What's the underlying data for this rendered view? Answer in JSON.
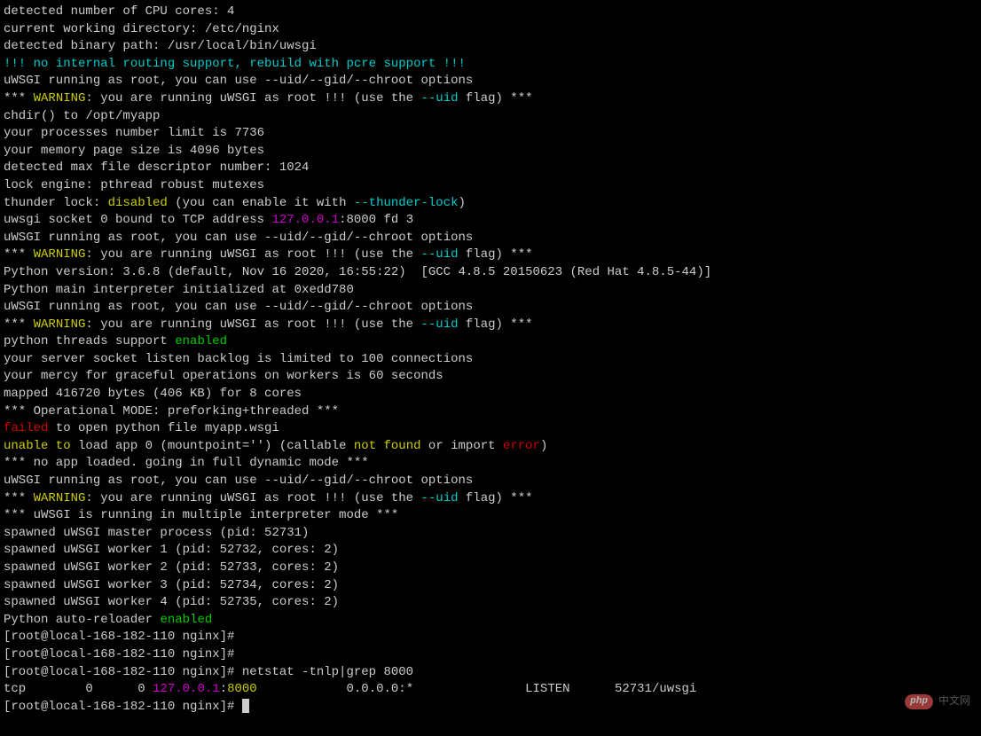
{
  "lines": [
    [
      {
        "t": "detected number of CPU cores: 4"
      }
    ],
    [
      {
        "t": "current working directory: /etc/nginx"
      }
    ],
    [
      {
        "t": "detected binary path: /usr/local/bin/uwsgi"
      }
    ],
    [
      {
        "t": "!!! no internal routing support, rebuild with pcre support !!!",
        "c": "cyan"
      }
    ],
    [
      {
        "t": "uWSGI running as root, you can use --uid/--gid/--chroot options"
      }
    ],
    [
      {
        "t": "*** "
      },
      {
        "t": "WARNING",
        "c": "yellow"
      },
      {
        "t": ": you are running uWSGI as root !!! (use the "
      },
      {
        "t": "--uid",
        "c": "cyan"
      },
      {
        "t": " flag) ***"
      }
    ],
    [
      {
        "t": "chdir() to /opt/myapp"
      }
    ],
    [
      {
        "t": "your processes number limit is 7736"
      }
    ],
    [
      {
        "t": "your memory page size is 4096 bytes"
      }
    ],
    [
      {
        "t": "detected max file descriptor number: 1024"
      }
    ],
    [
      {
        "t": "lock engine: pthread robust mutexes"
      }
    ],
    [
      {
        "t": "thunder lock: "
      },
      {
        "t": "disabled",
        "c": "yellow"
      },
      {
        "t": " (you can enable it with "
      },
      {
        "t": "--thunder-lock",
        "c": "cyan"
      },
      {
        "t": ")"
      }
    ],
    [
      {
        "t": "uwsgi socket 0 bound to TCP address "
      },
      {
        "t": "127.0.0.1",
        "c": "magenta"
      },
      {
        "t": ":8000 fd 3"
      }
    ],
    [
      {
        "t": "uWSGI running as root, you can use --uid/--gid/--chroot options"
      }
    ],
    [
      {
        "t": "*** "
      },
      {
        "t": "WARNING",
        "c": "yellow"
      },
      {
        "t": ": you are running uWSGI as root !!! (use the "
      },
      {
        "t": "--uid",
        "c": "cyan"
      },
      {
        "t": " flag) ***"
      }
    ],
    [
      {
        "t": "Python version: 3.6.8 (default, Nov 16 2020, 16:55:22)  [GCC 4.8.5 20150623 (Red Hat 4.8.5-44)]"
      }
    ],
    [
      {
        "t": "Python main interpreter initialized at 0xedd780"
      }
    ],
    [
      {
        "t": "uWSGI running as root, you can use --uid/--gid/--chroot options"
      }
    ],
    [
      {
        "t": "*** "
      },
      {
        "t": "WARNING",
        "c": "yellow"
      },
      {
        "t": ": you are running uWSGI as root !!! (use the "
      },
      {
        "t": "--uid",
        "c": "cyan"
      },
      {
        "t": " flag) ***"
      }
    ],
    [
      {
        "t": "python threads support "
      },
      {
        "t": "enabled",
        "c": "green"
      }
    ],
    [
      {
        "t": "your server socket listen backlog is limited to 100 connections"
      }
    ],
    [
      {
        "t": "your mercy for graceful operations on workers is 60 seconds"
      }
    ],
    [
      {
        "t": "mapped 416720 bytes (406 KB) for 8 cores"
      }
    ],
    [
      {
        "t": "*** Operational MODE: preforking+threaded ***"
      }
    ],
    [
      {
        "t": "failed",
        "c": "red"
      },
      {
        "t": " to open python file myapp.wsgi"
      }
    ],
    [
      {
        "t": "unable to",
        "c": "yellow"
      },
      {
        "t": " load app 0 (mountpoint='') (callable "
      },
      {
        "t": "not found",
        "c": "yellow"
      },
      {
        "t": " or import "
      },
      {
        "t": "error",
        "c": "red"
      },
      {
        "t": ")"
      }
    ],
    [
      {
        "t": "*** no app loaded. going in full dynamic mode ***"
      }
    ],
    [
      {
        "t": "uWSGI running as root, you can use --uid/--gid/--chroot options"
      }
    ],
    [
      {
        "t": "*** "
      },
      {
        "t": "WARNING",
        "c": "yellow"
      },
      {
        "t": ": you are running uWSGI as root !!! (use the "
      },
      {
        "t": "--uid",
        "c": "cyan"
      },
      {
        "t": " flag) ***"
      }
    ],
    [
      {
        "t": "*** uWSGI is running in multiple interpreter mode ***"
      }
    ],
    [
      {
        "t": "spawned uWSGI master process (pid: 52731)"
      }
    ],
    [
      {
        "t": "spawned uWSGI worker 1 (pid: 52732, cores: 2)"
      }
    ],
    [
      {
        "t": "spawned uWSGI worker 2 (pid: 52733, cores: 2)"
      }
    ],
    [
      {
        "t": "spawned uWSGI worker 3 (pid: 52734, cores: 2)"
      }
    ],
    [
      {
        "t": "spawned uWSGI worker 4 (pid: 52735, cores: 2)"
      }
    ],
    [
      {
        "t": "Python auto-reloader "
      },
      {
        "t": "enabled",
        "c": "green"
      }
    ],
    [
      {
        "t": "[root@local-168-182-110 nginx]# "
      }
    ],
    [
      {
        "t": "[root@local-168-182-110 nginx]# "
      }
    ],
    [
      {
        "t": "[root@local-168-182-110 nginx]# netstat -tnlp|grep 8000"
      }
    ],
    [
      {
        "t": "tcp        0      0 "
      },
      {
        "t": "127.0.0.1",
        "c": "magenta"
      },
      {
        "t": ":"
      },
      {
        "t": "8000",
        "c": "yellow"
      },
      {
        "t": "            0.0.0.0:*               LISTEN      52731/uwsgi  "
      }
    ],
    [
      {
        "t": "[root@local-168-182-110 nginx]# "
      },
      {
        "cursor": true
      }
    ]
  ],
  "watermark": {
    "badge": "php",
    "text": "中文网"
  }
}
